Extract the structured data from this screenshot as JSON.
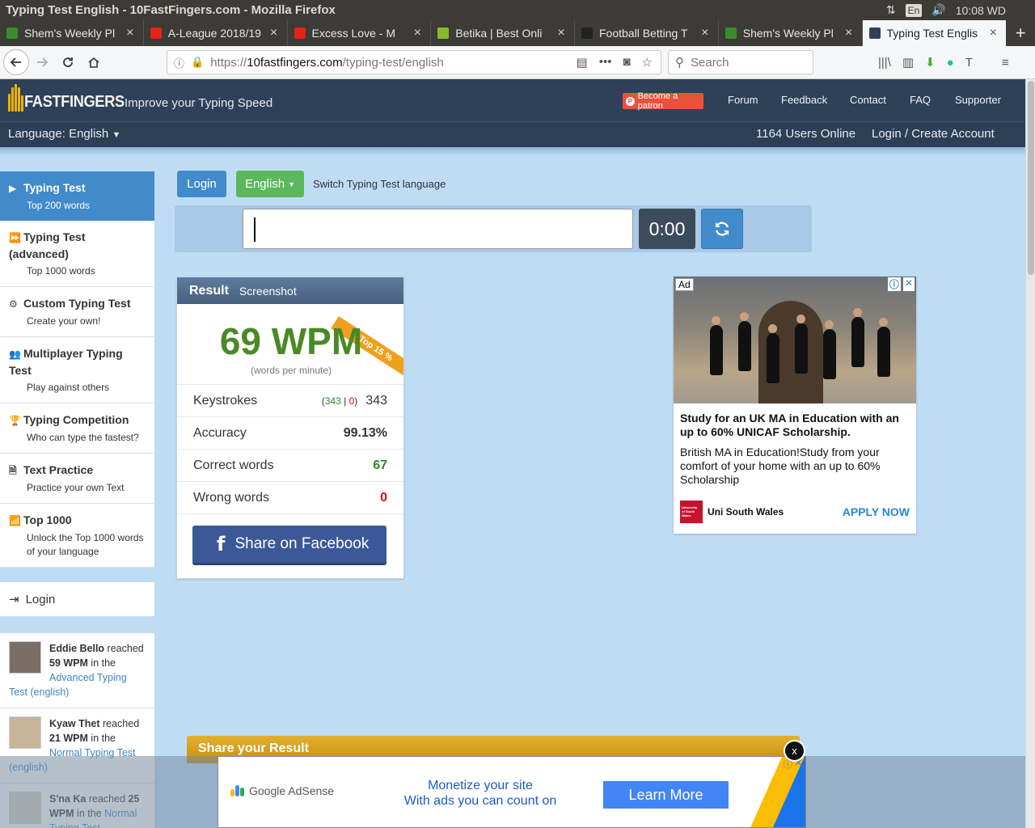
{
  "os": {
    "window_title": "Typing Test English - 10FastFingers.com - Mozilla Firefox",
    "keyboard_layout": "En",
    "clock": "10:08 WD"
  },
  "browser": {
    "tabs": [
      {
        "label": "Shem's Weekly Pl",
        "favicon_color": "#3b8a2e",
        "active": false
      },
      {
        "label": "A-League 2018/19",
        "favicon_color": "#e62117",
        "active": false
      },
      {
        "label": "Excess Love - M",
        "favicon_color": "#e62117",
        "active": false
      },
      {
        "label": "Betika | Best Onli",
        "favicon_color": "#8ab82a",
        "active": false
      },
      {
        "label": "Football Betting T",
        "favicon_color": "#222222",
        "active": false
      },
      {
        "label": "Shem's Weekly Pl",
        "favicon_color": "#3b8a2e",
        "active": false
      },
      {
        "label": "Typing Test Englis",
        "favicon_color": "#2e4158",
        "active": true
      }
    ],
    "url_prefix": "https://",
    "url_host": "10fastfingers.com",
    "url_path": "/typing-test/english",
    "search_placeholder": "Search"
  },
  "site": {
    "logo_text": "FASTFINGERS",
    "tagline": "Improve your Typing Speed",
    "patron_label": "Become a patron",
    "nav": [
      "Forum",
      "Feedback",
      "Contact",
      "FAQ",
      "Supporter"
    ],
    "language_label": "Language: English",
    "users_online": "1164 Users Online",
    "login_link": "Login",
    "login_sep": " / ",
    "create_account_link": "Create Account"
  },
  "sidebar": {
    "items": [
      {
        "title": "Typing Test",
        "sub": "Top 200 words",
        "icon": "play-icon",
        "active": true
      },
      {
        "title": "Typing Test (advanced)",
        "sub": "Top 1000 words",
        "icon": "fast-forward-icon",
        "active": false
      },
      {
        "title": "Custom Typing Test",
        "sub": "Create your own!",
        "icon": "gears-icon",
        "active": false
      },
      {
        "title": "Multiplayer Typing Test",
        "sub": "Play against others",
        "icon": "users-icon",
        "active": false
      },
      {
        "title": "Typing Competition",
        "sub": "Who can type the fastest?",
        "icon": "trophy-icon",
        "active": false
      },
      {
        "title": "Text Practice",
        "sub": "Practice your own Text",
        "icon": "document-icon",
        "active": false
      },
      {
        "title": "Top 1000",
        "sub": "Unlock the Top 1000 words of your language",
        "icon": "signal-icon",
        "active": false
      }
    ],
    "login_label": "Login",
    "activity": [
      {
        "name": "Eddie Bello",
        "pre": " reached ",
        "wpm": "59 WPM",
        "mid": " in the ",
        "link": "Advanced Typing Test (english)"
      },
      {
        "name": "Kyaw Thet",
        "pre": " reached ",
        "wpm": "21 WPM",
        "mid": " in the ",
        "link": "Normal Typing Test (english)"
      },
      {
        "name": "S'na Ka",
        "pre": " reached ",
        "wpm": "25 WPM",
        "mid": " in the ",
        "link": "Normal Typing Test"
      }
    ]
  },
  "controls": {
    "login_button": "Login",
    "language_button": "English",
    "switch_language": "Switch Typing Test language",
    "timer": "0:00"
  },
  "result": {
    "tab_result": "Result",
    "tab_screenshot": "Screenshot",
    "ribbon": "Top 15 %",
    "wpm": "69 WPM",
    "wpm_sub": "(words per minute)",
    "keystrokes_label": "Keystrokes",
    "keystrokes_correct": "343",
    "keystrokes_wrong": "0",
    "keystrokes_total": "343",
    "accuracy_label": "Accuracy",
    "accuracy": "99.13%",
    "correct_label": "Correct words",
    "correct": "67",
    "wrong_label": "Wrong words",
    "wrong": "0",
    "share_facebook": "Share on Facebook"
  },
  "ad": {
    "tag": "Ad",
    "title": "Study for an UK MA in Education with an up to 60% UNICAF Scholarship.",
    "desc": "British MA in Education!Study from your comfort of your home with an up to 60% Scholarship",
    "brand": "Uni South Wales",
    "brand_logo_text": "University of South Wales",
    "cta": "APPLY NOW"
  },
  "share": {
    "bar_title": "Share your Result",
    "close": "x"
  },
  "bottom_ad": {
    "brand": "Google AdSense",
    "line1": "Monetize your site",
    "line2": "With ads you can count on",
    "cta": "Learn More"
  }
}
